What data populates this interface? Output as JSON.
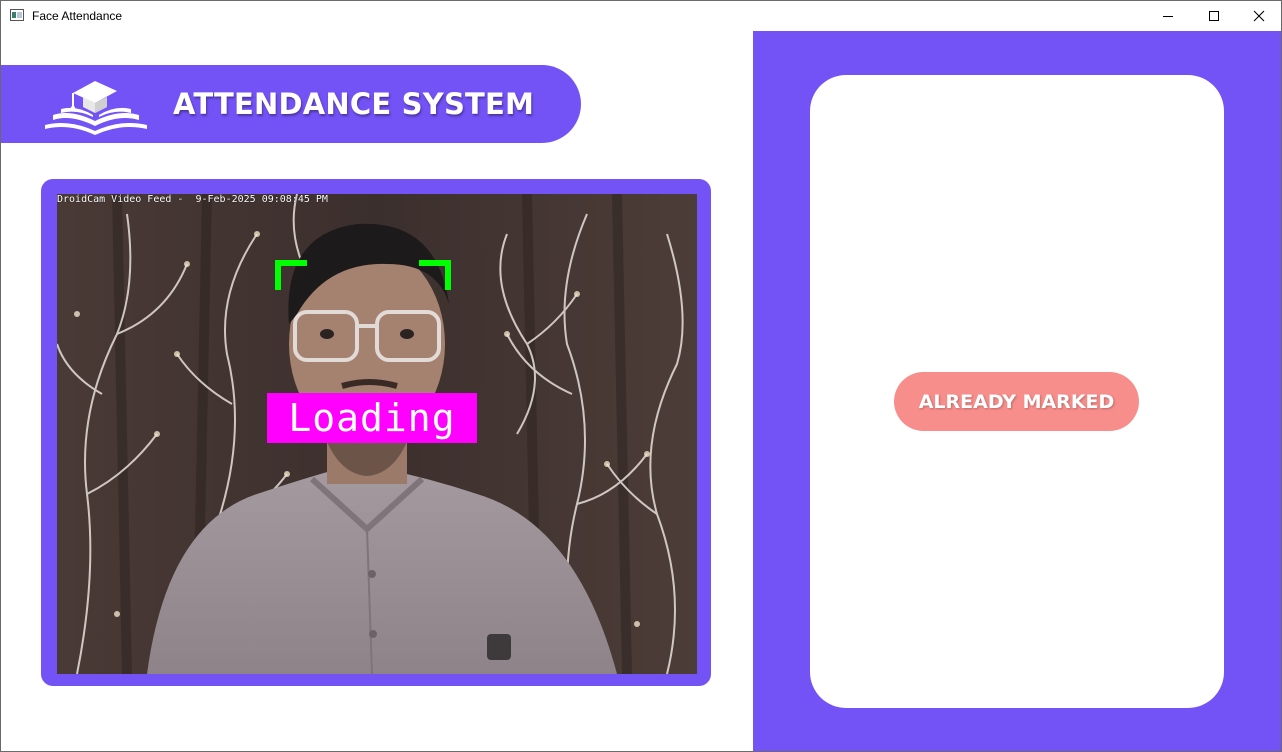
{
  "window": {
    "title": "Face Attendance",
    "controls": [
      "minimize-icon",
      "maximize-icon",
      "close-icon"
    ]
  },
  "header": {
    "title": "ATTENDANCE SYSTEM",
    "logo_icon": "graduation-book-icon"
  },
  "video": {
    "overlay_text": "DroidCam Video Feed -  9-Feb-2025 09:08:45 PM",
    "status_label": "Loading",
    "bracket_color": "#00ff00",
    "label_color": "#ff00ff"
  },
  "status": {
    "label": "ALREADY MARKED",
    "color": "#f88e8b"
  },
  "colors": {
    "accent": "#7352f6"
  }
}
